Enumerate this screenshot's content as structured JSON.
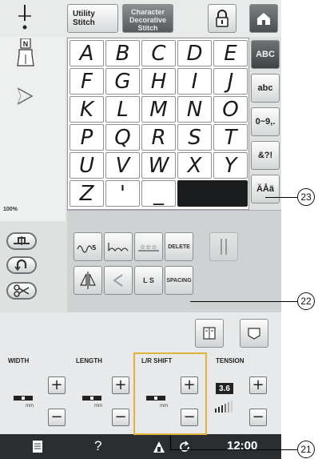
{
  "header": {
    "utility_tab": "Utility Stitch",
    "character_tab_lines": [
      "Character",
      "Decorative",
      "Stitch"
    ]
  },
  "grid": {
    "rows": [
      [
        "A",
        "B",
        "C",
        "D",
        "E"
      ],
      [
        "F",
        "G",
        "H",
        "I",
        "J"
      ],
      [
        "K",
        "L",
        "M",
        "N",
        "O"
      ],
      [
        "P",
        "Q",
        "R",
        "S",
        "T"
      ],
      [
        "U",
        "V",
        "W",
        "X",
        "Y"
      ],
      [
        "Z",
        "'",
        "_"
      ]
    ]
  },
  "modes": [
    "ABC",
    "abc",
    "0~9,.",
    "&?!",
    "ÄÅä"
  ],
  "sidebar": {
    "zoom_label": "100%"
  },
  "functions": {
    "delete_label": "DELETE",
    "spacing_label": "SPACING",
    "size_letters": "L S"
  },
  "settings": [
    {
      "label": "WIDTH",
      "unit": "mm"
    },
    {
      "label": "LENGTH",
      "unit": "mm"
    },
    {
      "label": "L/R SHIFT",
      "unit": "mm"
    },
    {
      "label": "TENSION",
      "value": "3.6"
    }
  ],
  "statusbar": {
    "help": "?",
    "clock": "12:00"
  },
  "callouts": {
    "c21": "21",
    "c22": "22",
    "c23": "23"
  }
}
